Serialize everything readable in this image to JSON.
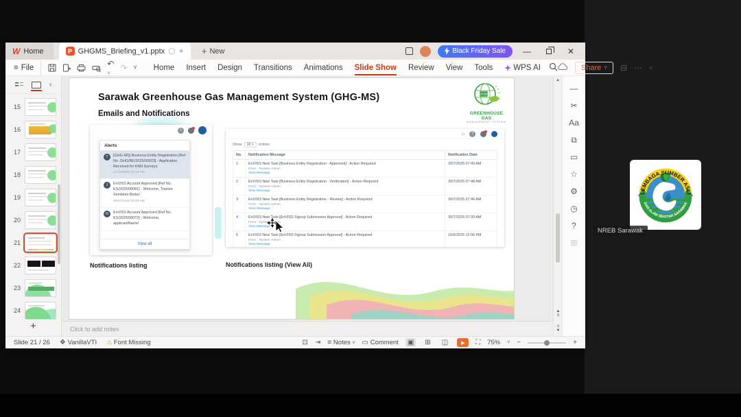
{
  "tabbar": {
    "home_label": "Home",
    "doc_tab_label": "GHGMS_Briefing_v1.pptx",
    "new_label": "New",
    "sale_label": "Black Friday Sale"
  },
  "menubar": {
    "file_label": "File",
    "items": [
      {
        "label": "Home"
      },
      {
        "label": "Insert"
      },
      {
        "label": "Design"
      },
      {
        "label": "Transitions"
      },
      {
        "label": "Animations"
      },
      {
        "label": "Slide Show",
        "active": true
      },
      {
        "label": "Review"
      },
      {
        "label": "View"
      },
      {
        "label": "Tools"
      },
      {
        "label": "WPS AI",
        "ai": true
      }
    ],
    "share_label": "Share"
  },
  "thumbnails": {
    "items": [
      {
        "num": "15",
        "variant": "doc"
      },
      {
        "num": "16",
        "variant": "yellow"
      },
      {
        "num": "17",
        "variant": "doc"
      },
      {
        "num": "18",
        "variant": "doc"
      },
      {
        "num": "19",
        "variant": "doc"
      },
      {
        "num": "20",
        "variant": "doc"
      },
      {
        "num": "21",
        "variant": "current",
        "selected": true
      },
      {
        "num": "22",
        "variant": "dark"
      },
      {
        "num": "23",
        "variant": "waveB"
      },
      {
        "num": "24",
        "variant": "wave"
      }
    ]
  },
  "slide": {
    "title": "Sarawak Greenhouse Gas Management System (GHG-MS)",
    "subtitle": "Emails and Notifications",
    "logo": {
      "badge": "NET 2050",
      "line1": "GREENHOUSE GAS",
      "line2": "MANAGEMENT SYSTEM"
    },
    "caption_left": "Notifications listing",
    "caption_right": "Notifications listing (View All)",
    "alerts_panel": {
      "title": "Alerts",
      "items": [
        {
          "avatar": "T",
          "text": "[GHG-MS] Business Entity Registration [Ref No. GHG/BE/2025/00023] - Application Received for KNN Surveys",
          "time": "21/10/2025 02:19 PM",
          "highlighted": true
        },
        {
          "avatar": "J",
          "text": "EnVISS Account Approved [Ref No. ES/2025/00081] - Welcome, Trainee Sembilan Belas!",
          "time": "30/07/2025 09:09 AM"
        },
        {
          "avatar": "N",
          "text": "EnVISS Account Approved [Ref No. ES/2025/00072] - Welcome, applicantName!",
          "time": ""
        }
      ],
      "view_all_label": "View all"
    },
    "table_panel": {
      "show_label": "Show",
      "show_value": "10",
      "entries_label": "entries",
      "headers": [
        "No.",
        "Notification Message",
        "Notification Date"
      ],
      "rows": [
        {
          "no": "1",
          "message": "EnVISS New Task [Business Entity Registration - Approved] - Action Required",
          "from": "From : System Admin",
          "link": "View Message",
          "date": "30/7/2025 07:49 AM"
        },
        {
          "no": "2",
          "message": "EnVISS New Task [Business Entity Registration - Verification] - Action Required",
          "from": "From : System Admin",
          "link": "View Message",
          "date": "30/7/2025 07:48 AM"
        },
        {
          "no": "3",
          "message": "EnVISS New Task [Business Entity Registration - Review] - Action Required",
          "from": "From : System Admin",
          "link": "View Message",
          "date": "30/7/2025 07:46 AM"
        },
        {
          "no": "4",
          "message": "EnVISS New Task [EnVISS Signup Submission Approval] - Action Required",
          "from": "From : System Admin",
          "link": "View Message",
          "date": "30/7/2025 07:39 AM"
        },
        {
          "no": "5",
          "message": "EnVISS New Task [EnVISS Signup Submission Approval] - Action Required",
          "from": "From : System Admin",
          "link": "View Message",
          "date": "16/6/2025 12:06 PM"
        }
      ]
    }
  },
  "right_toolbar": {
    "icons": [
      {
        "name": "collapse",
        "glyph": "—"
      },
      {
        "name": "tools",
        "glyph": "✂"
      },
      {
        "name": "theme",
        "glyph": "Aa"
      },
      {
        "name": "shapes",
        "glyph": "⧉"
      },
      {
        "name": "comment",
        "glyph": "▭"
      },
      {
        "name": "star",
        "glyph": "☆"
      },
      {
        "name": "settings",
        "glyph": "⚙"
      },
      {
        "name": "history",
        "glyph": "◷"
      },
      {
        "name": "help",
        "glyph": "?"
      },
      {
        "name": "apps",
        "glyph": "⊞",
        "dim": true
      }
    ]
  },
  "notes": {
    "placeholder": "Click to add notes"
  },
  "statusbar": {
    "slide_indicator": "Slide 21 / 26",
    "theme_name": "VanillaVTI",
    "font_warning": "Font Missing",
    "notes_label": "Notes",
    "comment_label": "Comment",
    "zoom_level": "75%"
  },
  "meeting": {
    "participant_name": "NREB Sarawak",
    "logo_top_text": "LEMBAGA SUMBER ASLI",
    "logo_bottom_text": "DAN ALAM SEKITAR SARAWAK"
  }
}
